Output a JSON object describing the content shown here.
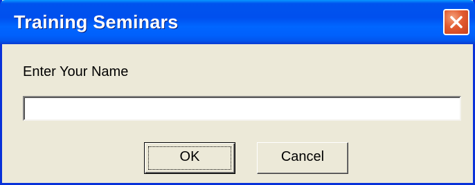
{
  "window": {
    "title": "Training Seminars",
    "close_icon": "close-icon",
    "accent_color": "#0054e3",
    "close_color": "#e25b30"
  },
  "dialog": {
    "prompt": "Enter Your Name",
    "name_value": "",
    "ok_label": "OK",
    "cancel_label": "Cancel"
  }
}
